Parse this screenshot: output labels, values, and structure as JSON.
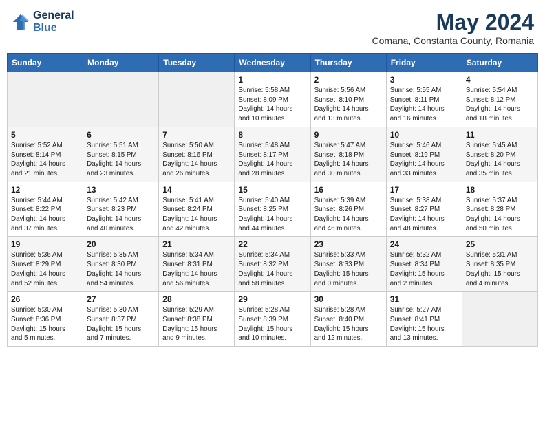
{
  "header": {
    "logo_line1": "General",
    "logo_line2": "Blue",
    "month_title": "May 2024",
    "subtitle": "Comana, Constanta County, Romania"
  },
  "days_of_week": [
    "Sunday",
    "Monday",
    "Tuesday",
    "Wednesday",
    "Thursday",
    "Friday",
    "Saturday"
  ],
  "weeks": [
    [
      {
        "day": "",
        "info": ""
      },
      {
        "day": "",
        "info": ""
      },
      {
        "day": "",
        "info": ""
      },
      {
        "day": "1",
        "info": "Sunrise: 5:58 AM\nSunset: 8:09 PM\nDaylight: 14 hours\nand 10 minutes."
      },
      {
        "day": "2",
        "info": "Sunrise: 5:56 AM\nSunset: 8:10 PM\nDaylight: 14 hours\nand 13 minutes."
      },
      {
        "day": "3",
        "info": "Sunrise: 5:55 AM\nSunset: 8:11 PM\nDaylight: 14 hours\nand 16 minutes."
      },
      {
        "day": "4",
        "info": "Sunrise: 5:54 AM\nSunset: 8:12 PM\nDaylight: 14 hours\nand 18 minutes."
      }
    ],
    [
      {
        "day": "5",
        "info": "Sunrise: 5:52 AM\nSunset: 8:14 PM\nDaylight: 14 hours\nand 21 minutes."
      },
      {
        "day": "6",
        "info": "Sunrise: 5:51 AM\nSunset: 8:15 PM\nDaylight: 14 hours\nand 23 minutes."
      },
      {
        "day": "7",
        "info": "Sunrise: 5:50 AM\nSunset: 8:16 PM\nDaylight: 14 hours\nand 26 minutes."
      },
      {
        "day": "8",
        "info": "Sunrise: 5:48 AM\nSunset: 8:17 PM\nDaylight: 14 hours\nand 28 minutes."
      },
      {
        "day": "9",
        "info": "Sunrise: 5:47 AM\nSunset: 8:18 PM\nDaylight: 14 hours\nand 30 minutes."
      },
      {
        "day": "10",
        "info": "Sunrise: 5:46 AM\nSunset: 8:19 PM\nDaylight: 14 hours\nand 33 minutes."
      },
      {
        "day": "11",
        "info": "Sunrise: 5:45 AM\nSunset: 8:20 PM\nDaylight: 14 hours\nand 35 minutes."
      }
    ],
    [
      {
        "day": "12",
        "info": "Sunrise: 5:44 AM\nSunset: 8:22 PM\nDaylight: 14 hours\nand 37 minutes."
      },
      {
        "day": "13",
        "info": "Sunrise: 5:42 AM\nSunset: 8:23 PM\nDaylight: 14 hours\nand 40 minutes."
      },
      {
        "day": "14",
        "info": "Sunrise: 5:41 AM\nSunset: 8:24 PM\nDaylight: 14 hours\nand 42 minutes."
      },
      {
        "day": "15",
        "info": "Sunrise: 5:40 AM\nSunset: 8:25 PM\nDaylight: 14 hours\nand 44 minutes."
      },
      {
        "day": "16",
        "info": "Sunrise: 5:39 AM\nSunset: 8:26 PM\nDaylight: 14 hours\nand 46 minutes."
      },
      {
        "day": "17",
        "info": "Sunrise: 5:38 AM\nSunset: 8:27 PM\nDaylight: 14 hours\nand 48 minutes."
      },
      {
        "day": "18",
        "info": "Sunrise: 5:37 AM\nSunset: 8:28 PM\nDaylight: 14 hours\nand 50 minutes."
      }
    ],
    [
      {
        "day": "19",
        "info": "Sunrise: 5:36 AM\nSunset: 8:29 PM\nDaylight: 14 hours\nand 52 minutes."
      },
      {
        "day": "20",
        "info": "Sunrise: 5:35 AM\nSunset: 8:30 PM\nDaylight: 14 hours\nand 54 minutes."
      },
      {
        "day": "21",
        "info": "Sunrise: 5:34 AM\nSunset: 8:31 PM\nDaylight: 14 hours\nand 56 minutes."
      },
      {
        "day": "22",
        "info": "Sunrise: 5:34 AM\nSunset: 8:32 PM\nDaylight: 14 hours\nand 58 minutes."
      },
      {
        "day": "23",
        "info": "Sunrise: 5:33 AM\nSunset: 8:33 PM\nDaylight: 15 hours\nand 0 minutes."
      },
      {
        "day": "24",
        "info": "Sunrise: 5:32 AM\nSunset: 8:34 PM\nDaylight: 15 hours\nand 2 minutes."
      },
      {
        "day": "25",
        "info": "Sunrise: 5:31 AM\nSunset: 8:35 PM\nDaylight: 15 hours\nand 4 minutes."
      }
    ],
    [
      {
        "day": "26",
        "info": "Sunrise: 5:30 AM\nSunset: 8:36 PM\nDaylight: 15 hours\nand 5 minutes."
      },
      {
        "day": "27",
        "info": "Sunrise: 5:30 AM\nSunset: 8:37 PM\nDaylight: 15 hours\nand 7 minutes."
      },
      {
        "day": "28",
        "info": "Sunrise: 5:29 AM\nSunset: 8:38 PM\nDaylight: 15 hours\nand 9 minutes."
      },
      {
        "day": "29",
        "info": "Sunrise: 5:28 AM\nSunset: 8:39 PM\nDaylight: 15 hours\nand 10 minutes."
      },
      {
        "day": "30",
        "info": "Sunrise: 5:28 AM\nSunset: 8:40 PM\nDaylight: 15 hours\nand 12 minutes."
      },
      {
        "day": "31",
        "info": "Sunrise: 5:27 AM\nSunset: 8:41 PM\nDaylight: 15 hours\nand 13 minutes."
      },
      {
        "day": "",
        "info": ""
      }
    ]
  ]
}
